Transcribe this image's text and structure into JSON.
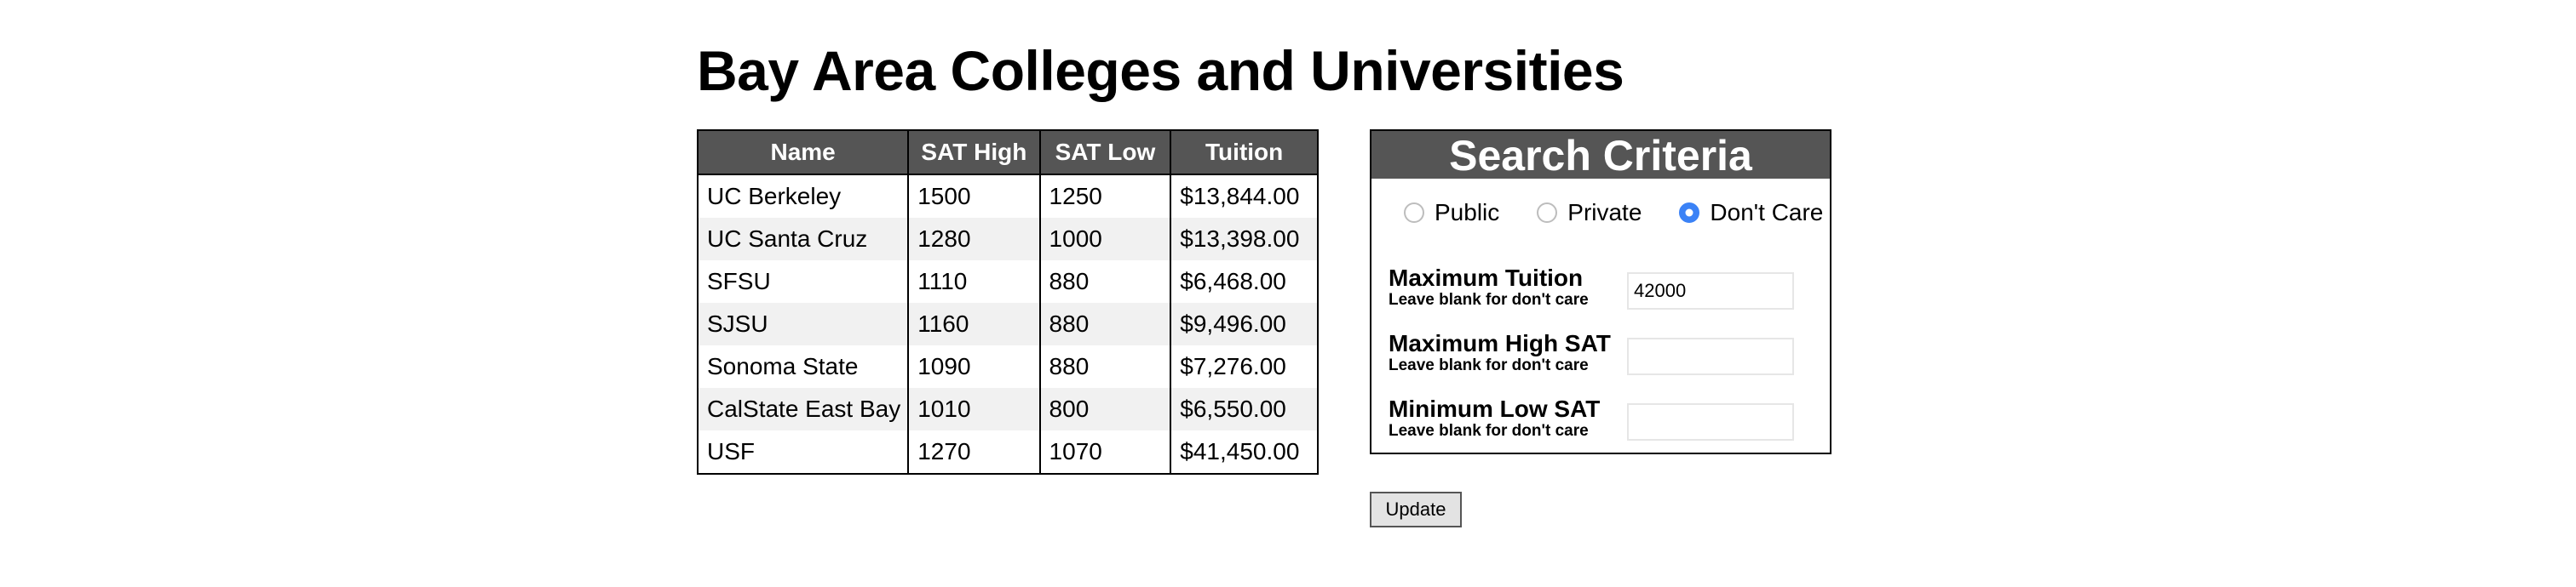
{
  "page_title": "Bay Area Colleges and Universities",
  "table": {
    "headers": [
      "Name",
      "SAT High",
      "SAT Low",
      "Tuition"
    ],
    "rows": [
      [
        "UC Berkeley",
        "1500",
        "1250",
        "$13,844.00"
      ],
      [
        "UC Santa Cruz",
        "1280",
        "1000",
        "$13,398.00"
      ],
      [
        "SFSU",
        "1110",
        "880",
        "$6,468.00"
      ],
      [
        "SJSU",
        "1160",
        "880",
        "$9,496.00"
      ],
      [
        "Sonoma State",
        "1090",
        "880",
        "$7,276.00"
      ],
      [
        "CalState East Bay",
        "1010",
        "800",
        "$6,550.00"
      ],
      [
        "USF",
        "1270",
        "1070",
        "$41,450.00"
      ]
    ]
  },
  "criteria": {
    "title": "Search Criteria",
    "radios": [
      {
        "label": "Public",
        "checked": false
      },
      {
        "label": "Private",
        "checked": false
      },
      {
        "label": "Don't Care",
        "checked": true
      }
    ],
    "fields": [
      {
        "label": "Maximum Tuition",
        "hint": "Leave blank for don't care",
        "value": "42000"
      },
      {
        "label": "Maximum High SAT",
        "hint": "Leave blank for don't care",
        "value": ""
      },
      {
        "label": "Minimum Low SAT",
        "hint": "Leave blank for don't care",
        "value": ""
      }
    ]
  },
  "update_label": "Update",
  "colors": {
    "header_bg": "#555555",
    "stripe": "#f1f1f1",
    "radio_accent": "#3b82f6"
  }
}
